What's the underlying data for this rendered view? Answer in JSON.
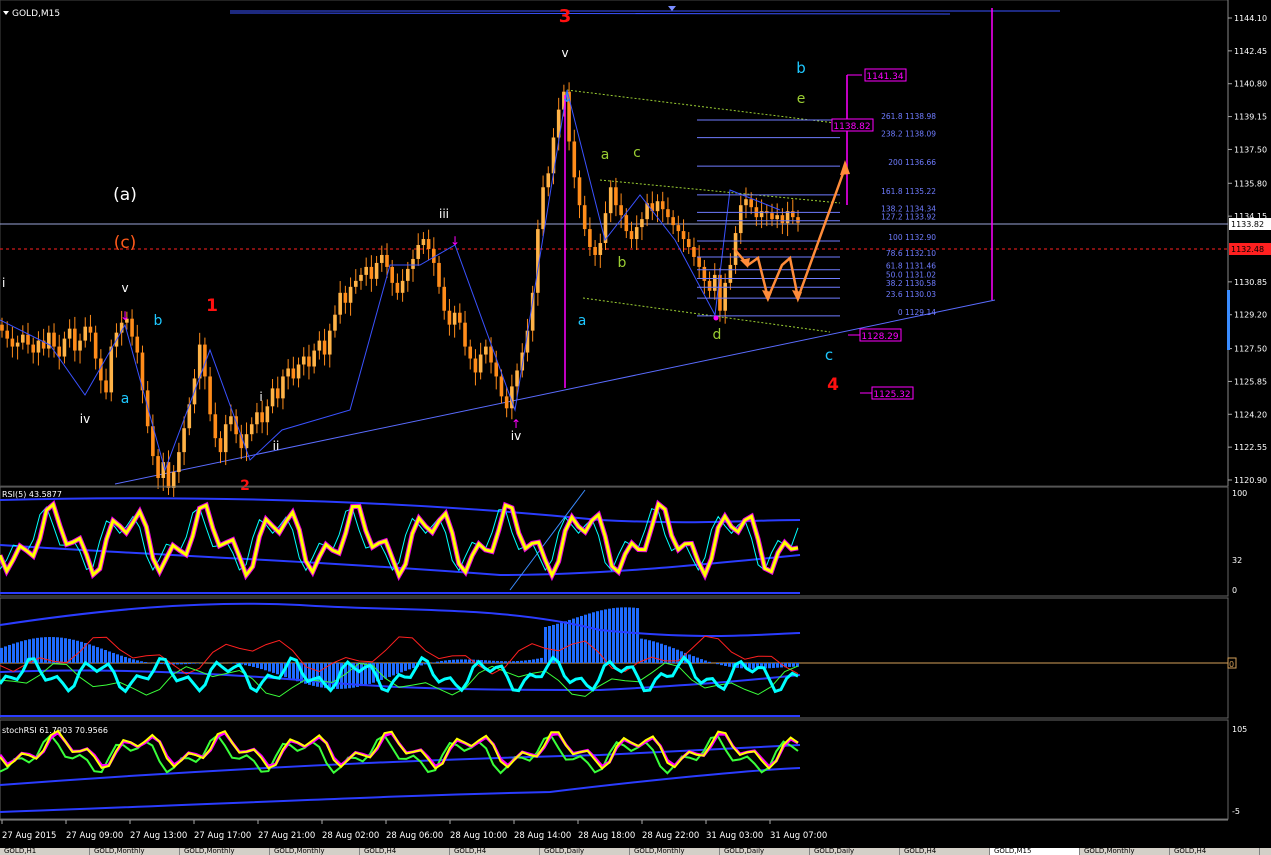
{
  "symbol_label": "GOLD,M15",
  "main_price_labels": [
    "1144.10",
    "1142.45",
    "1140.80",
    "1139.15",
    "1137.50",
    "1135.80",
    "1134.15",
    "1130.85",
    "1129.20",
    "1127.50",
    "1125.85",
    "1124.20",
    "1122.55",
    "1120.90"
  ],
  "current_price_tag": "1133.82",
  "level_price_tag": "1132.48",
  "fib_levels": [
    "261.8 1138.98",
    "238.2 1138.09",
    "200 1136.66",
    "161.8 1135.22",
    "138.2 1134.34",
    "127.2 1133.92",
    "100 1132.90",
    "78.6 1132.10",
    "61.8 1131.46",
    "50.0 1131.02",
    "38.2 1130.58",
    "23.6 1130.03",
    "0 1129.14"
  ],
  "target_boxes": [
    "1141.34",
    "1138.82",
    "1128.29",
    "1125.32"
  ],
  "wave_labels": {
    "w3_red": "3",
    "w1_red": "1",
    "w4_red": "4",
    "w2_red_partial": "2",
    "a_paren": "(a)",
    "c_paren": "(c)",
    "i_left": "i",
    "v_left": "v",
    "iv_left": "iv",
    "b_cyan_left": "b",
    "a_cyan_left": "a",
    "i_mid": "i",
    "ii_mid": "ii",
    "iii_top": "iii",
    "iv_bottom": "iv",
    "v_top": "v",
    "a_cyan_mid": "a",
    "a_green": "a",
    "c_green": "c",
    "b_green": "b",
    "d_green": "d",
    "e_green": "e",
    "b_cyan_right": "b",
    "c_cyan_right": "c"
  },
  "rsi": {
    "label": "RSI(5) 43.5877",
    "scale": [
      "100",
      "32",
      "0"
    ]
  },
  "osc": {
    "scale_mark": "0"
  },
  "stoch": {
    "label": "stochRSI 61.7903 70.9566",
    "scale": [
      "105",
      "-5"
    ]
  },
  "time_labels": [
    "27 Aug 2015",
    "27 Aug 09:00",
    "27 Aug 13:00",
    "27 Aug 17:00",
    "27 Aug 21:00",
    "28 Aug 02:00",
    "28 Aug 06:00",
    "28 Aug 10:00",
    "28 Aug 14:00",
    "28 Aug 18:00",
    "28 Aug 22:00",
    "31 Aug 03:00",
    "31 Aug 07:00"
  ],
  "tabs": [
    "GOLD,H1",
    "GOLD,Monthly",
    "GOLD,Monthly",
    "GOLD,Monthly",
    "GOLD,H4",
    "GOLD,H4",
    "GOLD,Daily",
    "GOLD,Monthly",
    "GOLD,Daily",
    "GOLD,Daily",
    "GOLD,H4",
    "GOLD,M15",
    "GOLD,Monthly",
    "GOLD,H4"
  ],
  "active_tab_index": 11,
  "colors": {
    "bg": "#000000",
    "candle": "#ff8c1a",
    "wave_line": "#3a52ff",
    "trend_line": "#5a6cff",
    "magenta": "#ff00ff",
    "red_level": "#ff2020",
    "fib": "#6f7cff",
    "rsi_main": "#ffff00",
    "cyan": "#00ffff",
    "histogram": "#1f6bff",
    "forecast_arrow": "#ff8c3a",
    "label_red": "#ff1010",
    "label_cyan": "#1ec8ff",
    "label_green": "#9acd32",
    "label_white": "#ffffff",
    "label_orange": "#ff5a1a"
  },
  "chart_data": {
    "type": "candlestick",
    "symbol": "GOLD",
    "timeframe": "M15",
    "ylim": [
      1120.9,
      1144.1
    ],
    "x_axis": [
      "27 Aug 2015",
      "27 Aug 09:00",
      "27 Aug 13:00",
      "27 Aug 17:00",
      "27 Aug 21:00",
      "28 Aug 02:00",
      "28 Aug 06:00",
      "28 Aug 10:00",
      "28 Aug 14:00",
      "28 Aug 18:00",
      "28 Aug 22:00",
      "31 Aug 03:00",
      "31 Aug 07:00"
    ],
    "close_path": [
      1128.4,
      1128.0,
      1127.6,
      1127.8,
      1128.2,
      1127.7,
      1127.3,
      1127.9,
      1127.5,
      1128.3,
      1127.6,
      1127.1,
      1128.0,
      1128.5,
      1127.4,
      1127.9,
      1128.6,
      1128.3,
      1127.0,
      1125.9,
      1125.3,
      1127.6,
      1128.3,
      1128.8,
      1129.0,
      1128.1,
      1127.3,
      1125.4,
      1123.6,
      1122.1,
      1121.0,
      1121.8,
      1120.5,
      1121.3,
      1122.3,
      1123.5,
      1124.7,
      1126.0,
      1127.7,
      1126.1,
      1124.2,
      1123.0,
      1122.3,
      1123.7,
      1124.1,
      1123.2,
      1122.5,
      1123.2,
      1123.7,
      1124.3,
      1123.8,
      1124.6,
      1125.5,
      1125.0,
      1126.1,
      1126.5,
      1126.0,
      1126.7,
      1127.1,
      1126.6,
      1127.4,
      1127.9,
      1127.2,
      1128.4,
      1129.2,
      1130.3,
      1129.8,
      1130.6,
      1130.9,
      1131.2,
      1131.6,
      1131.0,
      1131.8,
      1132.2,
      1131.6,
      1130.8,
      1130.3,
      1130.9,
      1131.5,
      1132.0,
      1132.7,
      1133.0,
      1132.5,
      1131.8,
      1130.6,
      1129.4,
      1128.7,
      1129.3,
      1128.8,
      1127.6,
      1127.0,
      1126.3,
      1127.2,
      1127.6,
      1126.8,
      1126.1,
      1125.1,
      1124.5,
      1125.6,
      1126.4,
      1127.3,
      1128.4,
      1130.3,
      1133.5,
      1135.6,
      1136.3,
      1138.1,
      1139.5,
      1140.4,
      1137.9,
      1136.1,
      1134.7,
      1133.5,
      1132.6,
      1132.2,
      1132.8,
      1134.3,
      1135.6,
      1134.7,
      1134.2,
      1133.4,
      1133.0,
      1133.6,
      1134.0,
      1134.8,
      1134.4,
      1134.9,
      1134.5,
      1134.1,
      1133.7,
      1133.4,
      1133.0,
      1132.6,
      1132.1,
      1131.6,
      1130.9,
      1130.4,
      1131.2,
      1129.4,
      1130.8,
      1131.7,
      1133.3,
      1134.7,
      1135.0,
      1134.6,
      1134.1,
      1134.4,
      1134.3,
      1134.0,
      1134.2,
      1133.8,
      1134.4,
      1134.1,
      1133.82
    ],
    "fibonacci": [
      {
        "ratio": "261.8",
        "price": 1138.98
      },
      {
        "ratio": "238.2",
        "price": 1138.09
      },
      {
        "ratio": "200",
        "price": 1136.66
      },
      {
        "ratio": "161.8",
        "price": 1135.22
      },
      {
        "ratio": "138.2",
        "price": 1134.34
      },
      {
        "ratio": "127.2",
        "price": 1133.92
      },
      {
        "ratio": "100",
        "price": 1132.9
      },
      {
        "ratio": "78.6",
        "price": 1132.1
      },
      {
        "ratio": "61.8",
        "price": 1131.46
      },
      {
        "ratio": "50.0",
        "price": 1131.02
      },
      {
        "ratio": "38.2",
        "price": 1130.58
      },
      {
        "ratio": "23.6",
        "price": 1130.03
      },
      {
        "ratio": "0",
        "price": 1129.14
      }
    ],
    "current_price": 1133.82,
    "horizontal_level": 1132.48,
    "targets": [
      1141.34,
      1138.82,
      1128.29,
      1125.32
    ],
    "rsi": {
      "period": 5,
      "value": 43.5877,
      "scale": [
        100,
        32,
        0
      ]
    },
    "stoch_rsi": {
      "k": 61.7903,
      "d": 70.9566,
      "scale": [
        105,
        -5
      ]
    }
  }
}
